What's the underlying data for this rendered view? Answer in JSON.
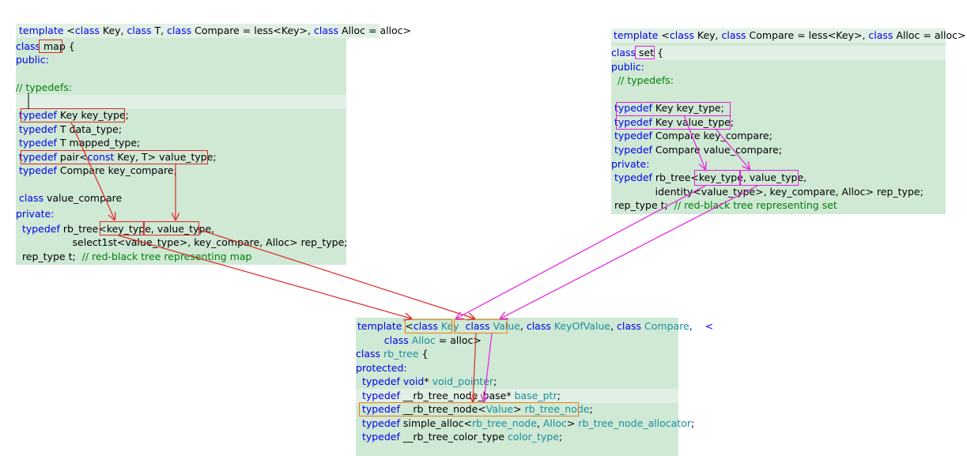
{
  "map_panel": {
    "lines": [
      [
        {
          "t": "template",
          "c": "kw"
        },
        {
          "t": " <"
        },
        {
          "t": "class",
          "c": "kw"
        },
        {
          "t": " Key, "
        },
        {
          "t": "class",
          "c": "kw"
        },
        {
          "t": " T, "
        },
        {
          "t": "class",
          "c": "kw"
        },
        {
          "t": " Compare = less<Key>, "
        },
        {
          "t": "class",
          "c": "kw"
        },
        {
          "t": " Alloc = alloc>"
        }
      ],
      [
        {
          "t": "class",
          "c": "kw"
        },
        {
          "t": " map {"
        }
      ],
      [
        {
          "t": "public:",
          "c": "kw"
        }
      ],
      [],
      [
        {
          "t": "// typedefs:",
          "c": "cm"
        }
      ],
      [],
      [
        {
          "t": " "
        },
        {
          "t": "typedef",
          "c": "kw"
        },
        {
          "t": " Key key_type;"
        }
      ],
      [
        {
          "t": " "
        },
        {
          "t": "typedef",
          "c": "kw"
        },
        {
          "t": " T data_type;"
        }
      ],
      [
        {
          "t": " "
        },
        {
          "t": "typedef",
          "c": "kw"
        },
        {
          "t": " T mapped_type;"
        }
      ],
      [
        {
          "t": " "
        },
        {
          "t": "typedef",
          "c": "kw"
        },
        {
          "t": " pair<"
        },
        {
          "t": "const",
          "c": "kw"
        },
        {
          "t": " Key, T> value_type;"
        }
      ],
      [
        {
          "t": " "
        },
        {
          "t": "typedef",
          "c": "kw"
        },
        {
          "t": " Compare key_compare;"
        }
      ],
      [],
      [
        {
          "t": " "
        },
        {
          "t": "class",
          "c": "kw"
        },
        {
          "t": " value_compare"
        }
      ],
      [
        {
          "t": "private:",
          "c": "kw"
        }
      ],
      [
        {
          "t": "  "
        },
        {
          "t": "typedef",
          "c": "kw"
        },
        {
          "t": " rb_tree<key_type, value_type,"
        }
      ],
      [
        {
          "t": "                  select1st<value_type>, key_compare, Alloc> rep_type;"
        }
      ],
      [
        {
          "t": "  rep_type t;  "
        },
        {
          "t": "// red-black tree representing map",
          "c": "cm"
        }
      ]
    ]
  },
  "set_panel": {
    "lines": [
      [
        {
          "t": "template",
          "c": "kw"
        },
        {
          "t": " <"
        },
        {
          "t": "class",
          "c": "kw"
        },
        {
          "t": " Key, "
        },
        {
          "t": "class",
          "c": "kw"
        },
        {
          "t": " Compare = less<Key>, "
        },
        {
          "t": "class",
          "c": "kw"
        },
        {
          "t": " Alloc = alloc>"
        }
      ],
      [
        {
          "t": "class",
          "c": "kw"
        },
        {
          "t": " set {"
        }
      ],
      [
        {
          "t": "public:",
          "c": "kw"
        }
      ],
      [
        {
          "t": "  "
        },
        {
          "t": "// typedefs:",
          "c": "cm"
        }
      ],
      [],
      [
        {
          "t": " "
        },
        {
          "t": "typedef",
          "c": "kw"
        },
        {
          "t": " Key key_type;"
        }
      ],
      [
        {
          "t": " "
        },
        {
          "t": "typedef",
          "c": "kw"
        },
        {
          "t": " Key value_type;"
        }
      ],
      [
        {
          "t": " "
        },
        {
          "t": "typedef",
          "c": "kw"
        },
        {
          "t": " Compare key_compare;"
        }
      ],
      [
        {
          "t": " "
        },
        {
          "t": "typedef",
          "c": "kw"
        },
        {
          "t": " Compare value_compare;"
        }
      ],
      [
        {
          "t": "private:",
          "c": "kw"
        }
      ],
      [
        {
          "t": " "
        },
        {
          "t": "typedef",
          "c": "kw"
        },
        {
          "t": " rb_tree<key_type, value_type,"
        }
      ],
      [
        {
          "t": "              identity<value_type>, key_compare, Alloc> rep_type;"
        }
      ],
      [
        {
          "t": " rep_type t;  "
        },
        {
          "t": "// red-black tree representing set",
          "c": "cm"
        }
      ]
    ]
  },
  "rbtree_panel": {
    "lines": [
      [
        {
          "t": "template",
          "c": "kw"
        },
        {
          "t": " <"
        },
        {
          "t": "class",
          "c": "kw"
        },
        {
          "t": " "
        },
        {
          "t": "Key",
          "c": "tp"
        },
        {
          "t": "  "
        },
        {
          "t": "class",
          "c": "kw"
        },
        {
          "t": " "
        },
        {
          "t": "Value",
          "c": "tp"
        },
        {
          "t": ", "
        },
        {
          "t": "class",
          "c": "kw"
        },
        {
          "t": " "
        },
        {
          "t": "KeyOfValue",
          "c": "tp"
        },
        {
          "t": ", "
        },
        {
          "t": "class",
          "c": "kw"
        },
        {
          "t": " "
        },
        {
          "t": "Compare",
          "c": "tp"
        },
        {
          "t": ",    <",
          "c": "kw"
        }
      ],
      [
        {
          "t": "         "
        },
        {
          "t": "class",
          "c": "kw"
        },
        {
          "t": " "
        },
        {
          "t": "Alloc",
          "c": "tp"
        },
        {
          "t": " = alloc>"
        }
      ],
      [
        {
          "t": "class",
          "c": "kw"
        },
        {
          "t": " "
        },
        {
          "t": "rb_tree",
          "c": "tp"
        },
        {
          "t": " {"
        }
      ],
      [
        {
          "t": "protected:",
          "c": "kw"
        }
      ],
      [
        {
          "t": "  "
        },
        {
          "t": "typedef",
          "c": "kw"
        },
        {
          "t": " "
        },
        {
          "t": "void",
          "c": "kw"
        },
        {
          "t": "* "
        },
        {
          "t": "void_pointer",
          "c": "tp"
        },
        {
          "t": ";"
        }
      ],
      [
        {
          "t": "  "
        },
        {
          "t": "typedef",
          "c": "kw"
        },
        {
          "t": " __rb_tree_node_base* "
        },
        {
          "t": "base_ptr",
          "c": "tp"
        },
        {
          "t": ";"
        }
      ],
      [
        {
          "t": "  "
        },
        {
          "t": "typedef",
          "c": "kw"
        },
        {
          "t": " __rb_tree_node<"
        },
        {
          "t": "Value",
          "c": "tp"
        },
        {
          "t": "> "
        },
        {
          "t": "rb_tree_node",
          "c": "tp"
        },
        {
          "t": ";"
        }
      ],
      [
        {
          "t": "  "
        },
        {
          "t": "typedef",
          "c": "kw"
        },
        {
          "t": " simple_alloc<"
        },
        {
          "t": "rb_tree_node",
          "c": "tp"
        },
        {
          "t": ", "
        },
        {
          "t": "Alloc",
          "c": "tp"
        },
        {
          "t": "> "
        },
        {
          "t": "rb_tree_node_allocator",
          "c": "tp"
        },
        {
          "t": ";"
        }
      ],
      [
        {
          "t": "  "
        },
        {
          "t": "typedef",
          "c": "kw"
        },
        {
          "t": " __rb_tree_color_type "
        },
        {
          "t": "color_type",
          "c": "tp"
        },
        {
          "t": ";"
        }
      ]
    ]
  },
  "colors": {
    "panel_bg": "#cfe9d4",
    "keyword": "#0000ee",
    "comment": "#00800a",
    "type_name": "#1b8ea0",
    "map_arrows": "#e0262a",
    "set_arrows": "#e81ce3",
    "rbtree_boxes": "#ee7a12"
  }
}
